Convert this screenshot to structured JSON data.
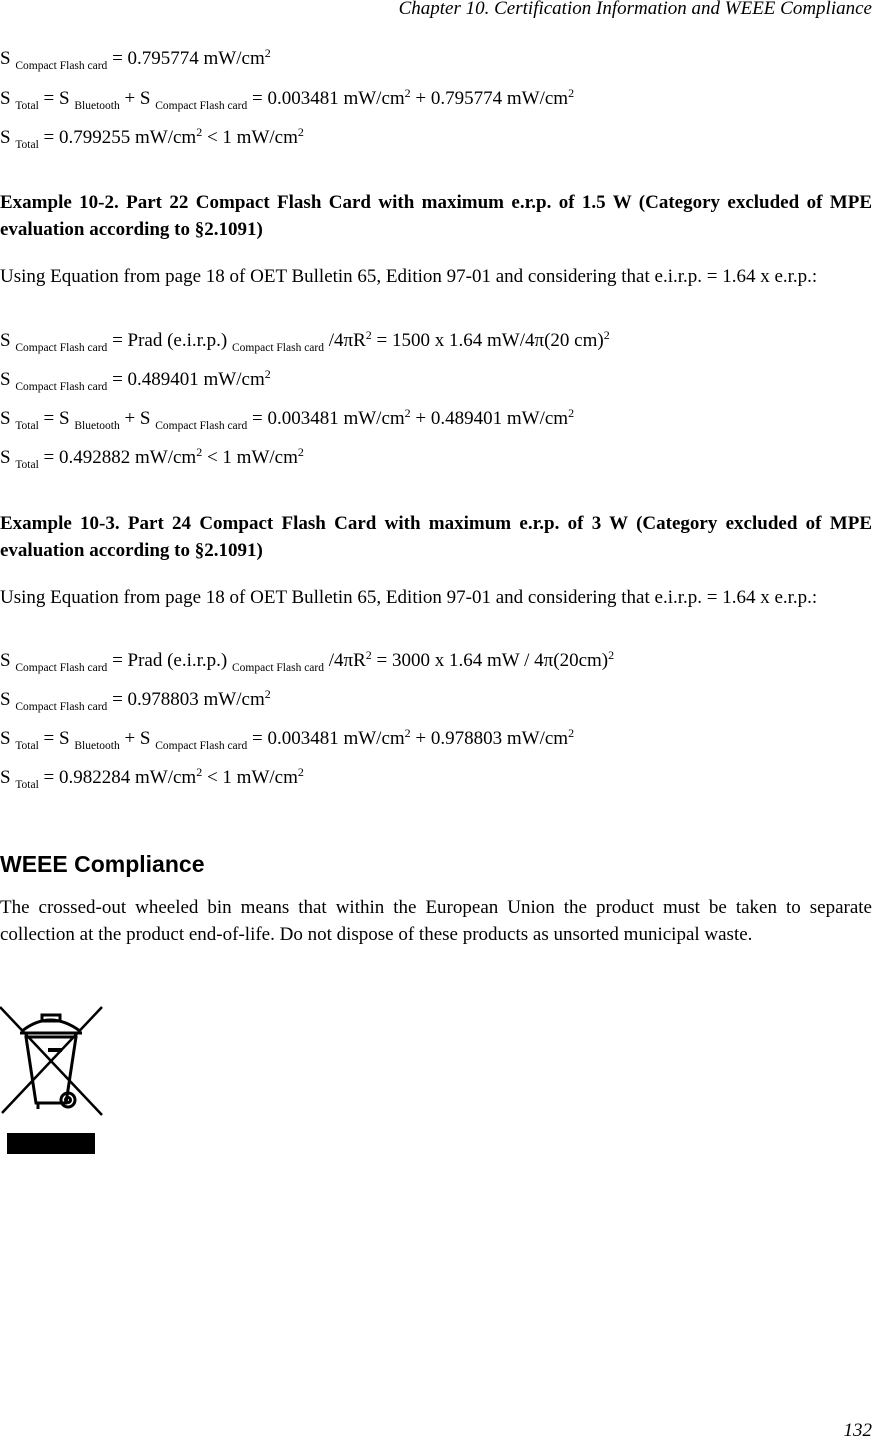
{
  "header": {
    "running_title": "Chapter 10. Certification Information and WEEE Compliance"
  },
  "block1": {
    "lines": [
      {
        "pre": "S ",
        "sub1": "Compact Flash card",
        "text": " = 0.795774 mW/cm",
        "sup": "2"
      },
      {
        "pre": "S ",
        "sub1": "Total",
        "mid1": " = S ",
        "sub2": "Bluetooth",
        "mid2": " + S ",
        "sub3": "Compact Flash card",
        "mid3": " = 0.003481 mW/cm",
        "sup1": "2",
        "mid4": " + 0.795774 mW/cm",
        "sup2": "2"
      },
      {
        "pre": "S ",
        "sub1": "Total",
        "text": " = 0.799255 mW/cm",
        "sup1": "2",
        "text2": " < 1 mW/cm",
        "sup2": "2"
      }
    ]
  },
  "example2": {
    "title": "Example 10-2. Part 22 Compact Flash Card with maximum e.r.p. of 1.5 W (Category excluded of MPE evaluation according to §2.1091)",
    "intro": "Using Equation from page 18 of OET Bulletin 65, Edition 97-01 and considering that e.i.r.p. = 1.64 x e.r.p.:",
    "eq1": {
      "pre": "S ",
      "sub1": "Compact Flash card",
      "mid1": " = Prad (e.i.r.p.) ",
      "sub2": "Compact Flash card",
      "mid2": " /4πR",
      "sup1": "2",
      "mid3": " = 1500 x 1.64 mW/4π(20 cm)",
      "sup2": "2"
    },
    "eq2": {
      "pre": "S ",
      "sub1": "Compact Flash card",
      "text": " = 0.489401 mW/cm",
      "sup": "2"
    },
    "eq3": {
      "pre": "S ",
      "sub1": "Total",
      "mid1": " = S ",
      "sub2": "Bluetooth",
      "mid2": " + S ",
      "sub3": "Compact Flash card",
      "mid3": " = 0.003481 mW/cm",
      "sup1": "2",
      "mid4": " + 0.489401 mW/cm",
      "sup2": "2"
    },
    "eq4": {
      "pre": "S ",
      "sub1": "Total",
      "text": " = 0.492882 mW/cm",
      "sup1": "2",
      "text2": " < 1 mW/cm",
      "sup2": "2"
    }
  },
  "example3": {
    "title": "Example 10-3. Part 24 Compact Flash Card with maximum e.r.p. of 3 W (Category excluded of MPE evaluation according to §2.1091)",
    "intro": "Using Equation from page 18 of OET Bulletin 65, Edition 97-01 and considering that e.i.r.p. = 1.64 x e.r.p.:",
    "eq1": {
      "pre": "S ",
      "sub1": "Compact Flash card",
      "mid1": " = Prad (e.i.r.p.) ",
      "sub2": "Compact Flash card",
      "mid2": " /4πR",
      "sup1": "2",
      "mid3": " = 3000 x 1.64 mW / 4π(20cm)",
      "sup2": "2"
    },
    "eq2": {
      "pre": "S ",
      "sub1": "Compact Flash card",
      "text": " = 0.978803 mW/cm",
      "sup": "2"
    },
    "eq3": {
      "pre": "S ",
      "sub1": "Total",
      "mid1": " = S ",
      "sub2": "Bluetooth",
      "mid2": " + S ",
      "sub3": "Compact Flash card",
      "mid3": " = 0.003481 mW/cm",
      "sup1": "2",
      "mid4": " + 0.978803 mW/cm",
      "sup2": "2"
    },
    "eq4": {
      "pre": "S ",
      "sub1": "Total",
      "text": " = 0.982284 mW/cm",
      "sup1": "2",
      "text2": " < 1 mW/cm",
      "sup2": "2"
    }
  },
  "weee": {
    "title": "WEEE Compliance",
    "body": "The crossed-out wheeled bin means that within the European Union the product must be taken to separate collection at the product end-of-life. Do not dispose of these products as unsorted municipal waste.",
    "icon": "crossed-out-wheeled-bin-icon"
  },
  "footer": {
    "page_number": "132"
  }
}
